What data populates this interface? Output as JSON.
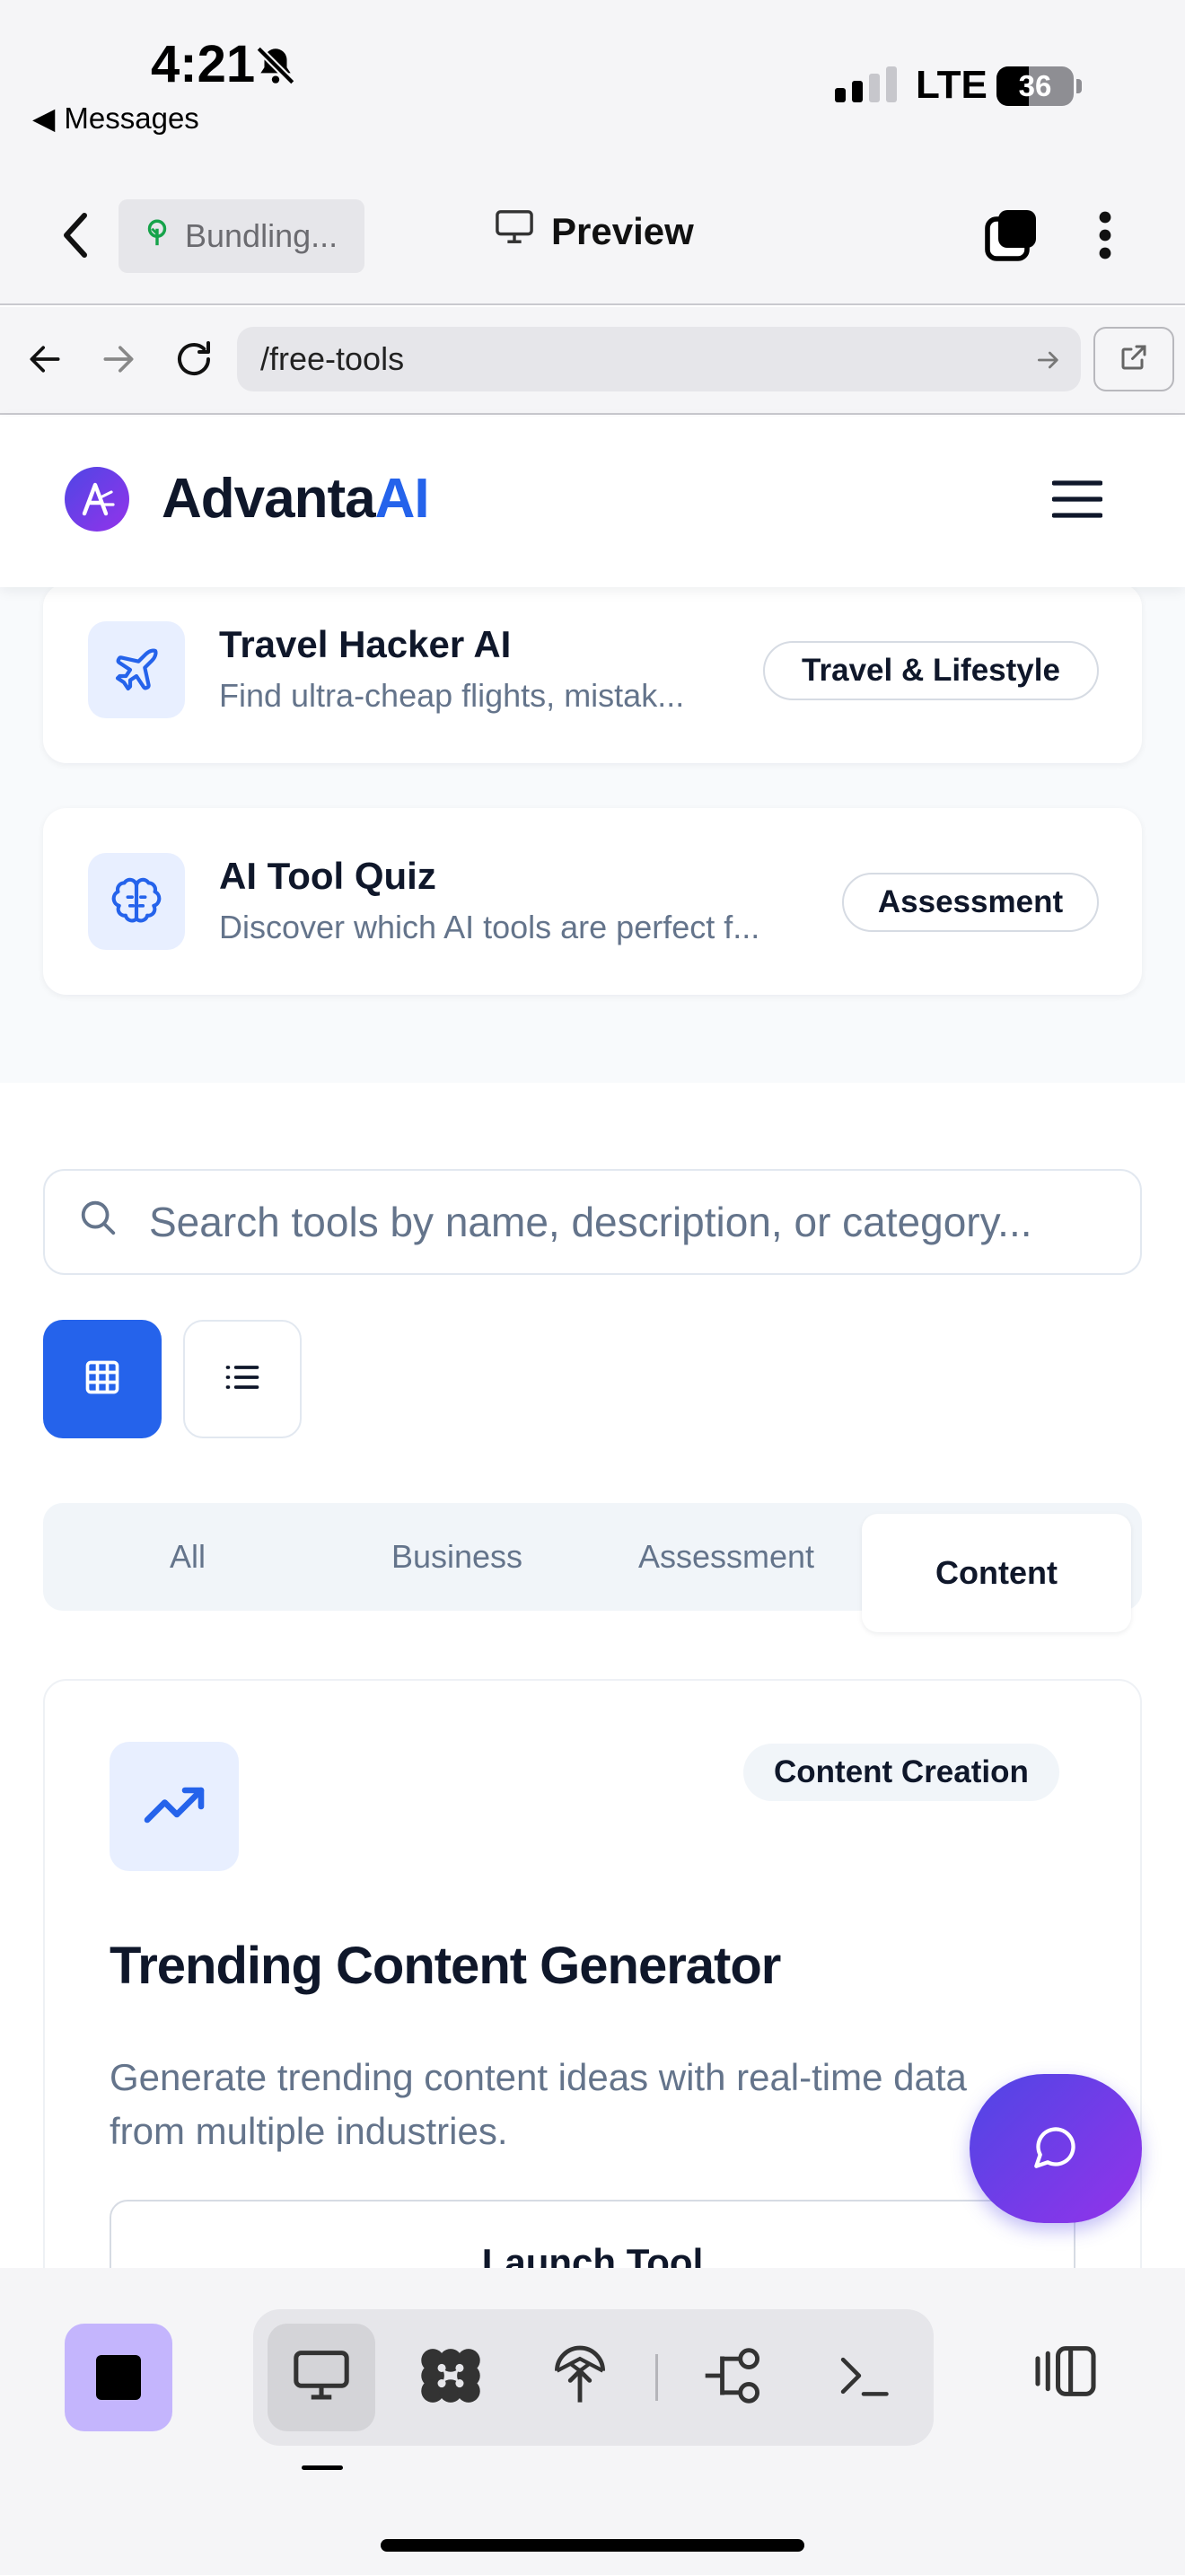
{
  "status_bar": {
    "time": "4:21",
    "back_app": "Messages",
    "network": "LTE",
    "battery": "36"
  },
  "app_header": {
    "project_label": "Bundling...",
    "preview_label": "Preview"
  },
  "url_bar": {
    "path": "/free-tools"
  },
  "site": {
    "brand_main": "Advanta",
    "brand_accent": "AI",
    "brand_accent_color": "#2563eb"
  },
  "tools": [
    {
      "name": "Travel Hacker AI",
      "description": "Find ultra-cheap flights, mistak...",
      "category": "Travel & Lifestyle",
      "icon": "plane-icon"
    },
    {
      "name": "AI Tool Quiz",
      "description": "Discover which AI tools are perfect f...",
      "category": "Assessment",
      "icon": "brain-icon"
    }
  ],
  "search": {
    "placeholder": "Search tools by name, description, or category..."
  },
  "category_tabs": [
    "All",
    "Business",
    "Assessment",
    "Content"
  ],
  "active_category": "Content",
  "featured": {
    "badge": "Content Creation",
    "title": "Trending Content Generator",
    "description": "Generate trending content ideas with real-time data from multiple industries.",
    "button": "Launch Tool",
    "icon": "trending-up-icon"
  },
  "bottom_toolbar": {
    "tools": [
      "monitor-icon",
      "puzzle-icon",
      "deploy-icon",
      "git-branch-icon",
      "terminal-icon"
    ],
    "selected": "monitor-icon"
  },
  "colors": {
    "primary": "#2563eb",
    "gradient_start": "#4f46e5",
    "gradient_end": "#9333ea",
    "stop_button": "#c4b5fd"
  }
}
